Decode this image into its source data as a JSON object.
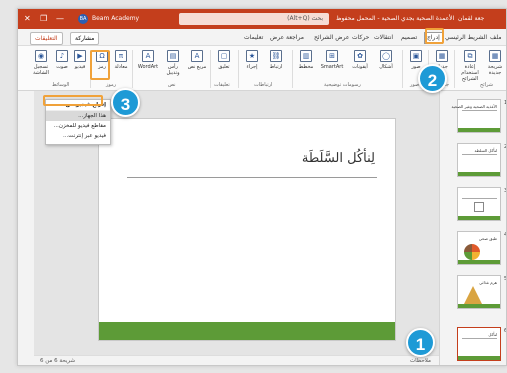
{
  "window": {
    "title": "الأعمدة الصحية بجدي الصحية - المحمل محفوظ",
    "search_placeholder": "بحث (Alt+Q)",
    "account": "Beam Academy",
    "account_initials": "BA",
    "user": "جعة لقمان"
  },
  "tabs": [
    "ملف",
    "الشريط الرئيسي",
    "إدراج",
    "تصميم",
    "انتقالات",
    "حركات",
    "عرض الشرائح",
    "مراجعة",
    "عرض",
    "تعليمات"
  ],
  "active_tab": "إدراج",
  "share_label": "مشاركة",
  "comments_label": "التعليقات",
  "ribbon": {
    "buttons": [
      {
        "label": "شريحة جديدة",
        "glyph": "▦"
      },
      {
        "label": "إعادة استخدام الشرائح",
        "glyph": "⧉"
      },
      {
        "label": "جدول",
        "glyph": "▦"
      },
      {
        "label": "صور",
        "glyph": "▣"
      },
      {
        "label": "أشكال",
        "glyph": "◯"
      },
      {
        "label": "أيقونات",
        "glyph": "✿"
      },
      {
        "label": "SmartArt",
        "glyph": "⊞"
      },
      {
        "label": "مخطط",
        "glyph": "▥"
      },
      {
        "label": "ارتباط",
        "glyph": "⛓"
      },
      {
        "label": "إجراء",
        "glyph": "★"
      },
      {
        "label": "تعليق",
        "glyph": "▢"
      },
      {
        "label": "مربع نص",
        "glyph": "A"
      },
      {
        "label": "رأس وتذييل",
        "glyph": "▤"
      },
      {
        "label": "WordArt",
        "glyph": "A"
      },
      {
        "label": "معادلة",
        "glyph": "π"
      },
      {
        "label": "رمز",
        "glyph": "Ω"
      },
      {
        "label": "فيديو",
        "glyph": "▶"
      },
      {
        "label": "صوت",
        "glyph": "♪"
      },
      {
        "label": "تسجيل الشاشة",
        "glyph": "◉"
      }
    ],
    "groups": [
      "شرائح",
      "جداول",
      "صور",
      "رسومات توضيحية",
      "ارتباطات",
      "تعليقات",
      "نص",
      "رموز",
      "الوسائط"
    ]
  },
  "dropdown": {
    "header": "إدراج فيديو من",
    "items": [
      "هذا الجهاز...",
      "مقاطع فيديو للمخزن...",
      "فيديو عبر إنترنت..."
    ]
  },
  "slide": {
    "title": "لِنأكُل السَّلَطَة"
  },
  "thumbnails": [
    {
      "num": "1",
      "title": "الأغذية الصحية وغير الصحية"
    },
    {
      "num": "2",
      "title": "لنأكل السلطة"
    },
    {
      "num": "3",
      "title": ""
    },
    {
      "num": "4",
      "title": "طبق صحي"
    },
    {
      "num": "5",
      "title": "هرم غذائي"
    },
    {
      "num": "6",
      "title": "لنأكل"
    }
  ],
  "status": {
    "notes": "ملاحظات",
    "slide_info": "شريحة 6 من 6"
  },
  "callouts": [
    "1",
    "2",
    "3"
  ]
}
